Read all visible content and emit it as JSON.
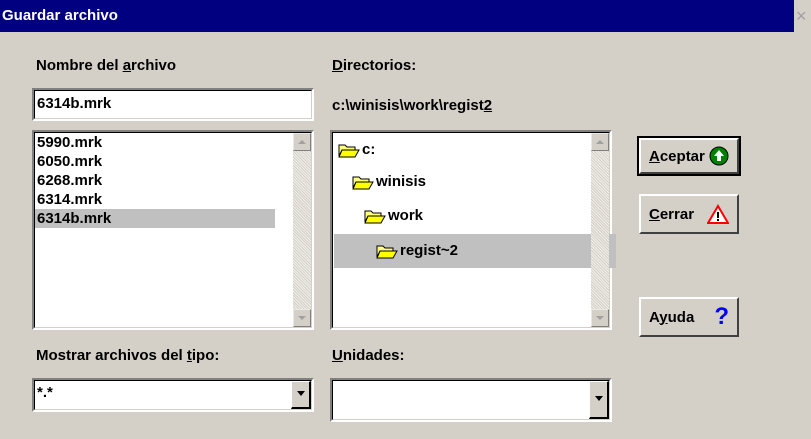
{
  "window": {
    "title": "Guardar archivo",
    "close_glyph": "×"
  },
  "filename": {
    "label_pre": "Nombre del ",
    "label_key": "a",
    "label_post": "rchivo",
    "value": "6314b.mrk"
  },
  "files": {
    "items": [
      "5990.mrk",
      "6050.mrk",
      "6268.mrk",
      "6314.mrk",
      "6314b.mrk"
    ],
    "selected": "6314b.mrk"
  },
  "directories": {
    "label_key": "D",
    "label_post": "irectorios:",
    "path_pre": "c:\\winisis\\work\\regist",
    "path_key": "2",
    "tree": [
      {
        "name": "c:",
        "icon": "open-folder-icon"
      },
      {
        "name": "winisis",
        "icon": "open-folder-icon"
      },
      {
        "name": "work",
        "icon": "open-folder-icon"
      },
      {
        "name": "regist~2",
        "icon": "open-folder-icon"
      }
    ]
  },
  "filetype": {
    "label_pre": "Mostrar archivos del ",
    "label_key": "t",
    "label_post": "ipo:",
    "value": "*.*"
  },
  "drives": {
    "label_key": "U",
    "label_post": "nidades:",
    "value": ""
  },
  "buttons": {
    "accept": {
      "key": "A",
      "rest": "ceptar",
      "icon": "green-check-circle-icon"
    },
    "close": {
      "key": "C",
      "rest": "errar",
      "icon": "warning-triangle-icon"
    },
    "help": {
      "pre": "A",
      "key": "y",
      "rest": "uda",
      "icon": "question-mark-icon"
    }
  },
  "colors": {
    "titlebar": "#000080",
    "face": "#d4d0c8",
    "accept_green": "#008000",
    "warning_red": "#ff0000",
    "help_blue": "#0000ff"
  }
}
